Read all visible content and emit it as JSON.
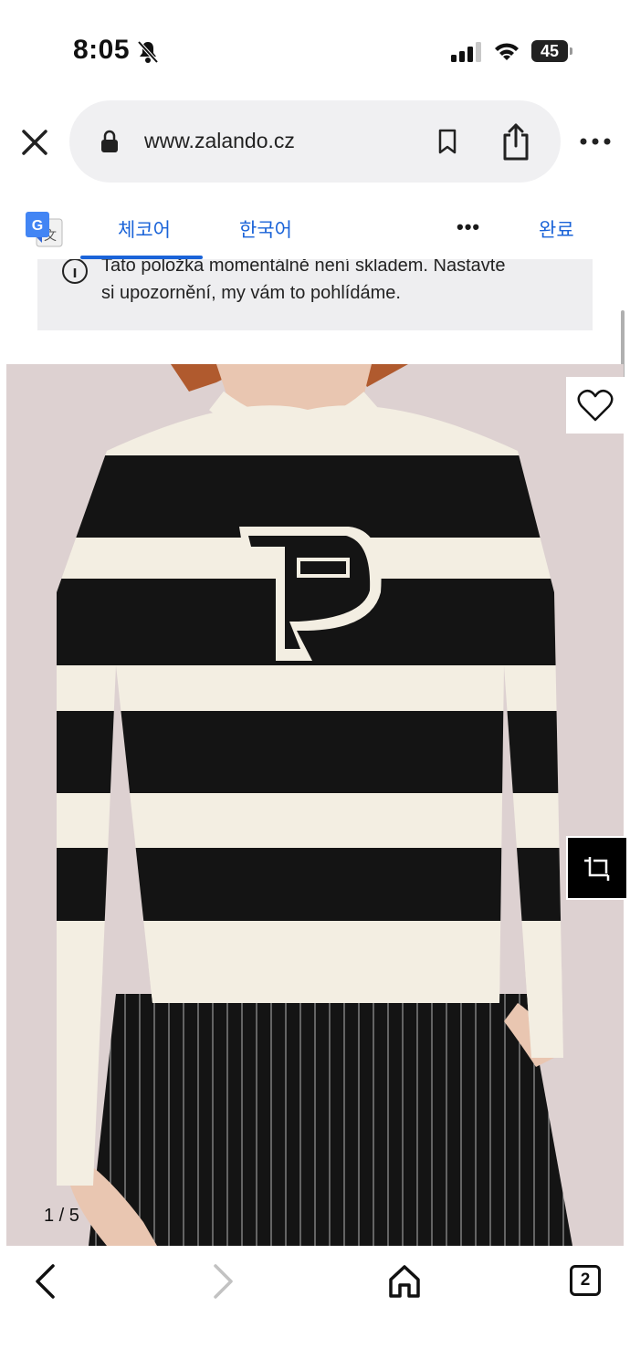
{
  "status_bar": {
    "time": "8:05",
    "battery": "45"
  },
  "browser": {
    "url": "www.zalando.cz"
  },
  "translate_bar": {
    "source_lang": "체코어",
    "target_lang": "한국어",
    "more": "•••",
    "done": "완료"
  },
  "notice": {
    "line1": "Tato položka momentálně není skladem. Nastavte",
    "line2": "si upozornění, my vám to pohlídáme."
  },
  "gallery": {
    "page_indicator": "1 / 5"
  },
  "toolbar": {
    "tabs_count": "2"
  },
  "icons": {
    "bell": "bell-slash-icon",
    "lock": "lock-icon",
    "bookmark": "bookmark-icon",
    "share": "share-icon",
    "heart": "heart-icon",
    "crop": "crop-icon",
    "back": "chevron-left-icon",
    "forward": "chevron-right-icon",
    "home": "home-icon"
  },
  "colors": {
    "accent": "#1a63d8",
    "notice_bg": "#eeeef0",
    "image_bg": "#ddd1d1"
  }
}
